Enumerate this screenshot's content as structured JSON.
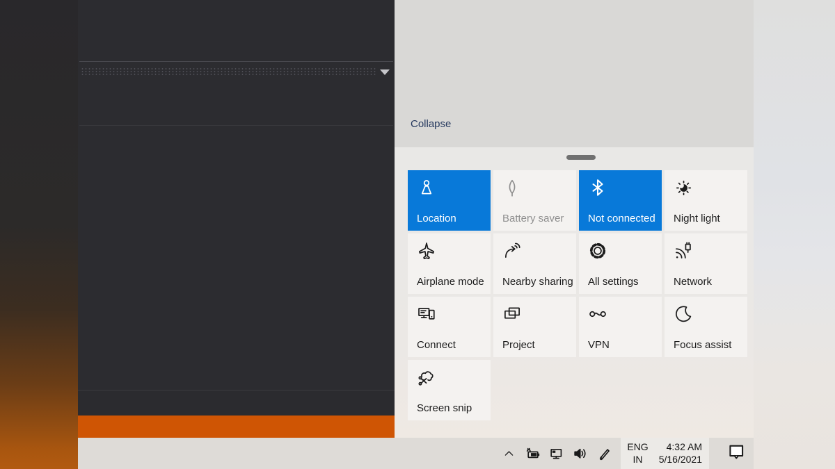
{
  "colors": {
    "accent_blue": "#0879d9",
    "orange_bar": "#cf5504",
    "dark_window": "#2c2c30",
    "panel_top_bg": "#d9d8d6",
    "panel_quick_actions_bg": "#e9e8e6",
    "tile_bg": "#f4f2f0",
    "taskbar_bg": "#dedbd7",
    "collapse_text": "#26395f"
  },
  "app_window": {
    "dropdown_icon": "chevron-down-caret"
  },
  "action_center": {
    "collapse_label": "Collapse",
    "drag_handle": "drag-handle",
    "tiles": [
      {
        "label": "Location",
        "icon": "location",
        "state": "active"
      },
      {
        "label": "Battery saver",
        "icon": "leaf",
        "state": "disabled"
      },
      {
        "label": "Not connected",
        "icon": "bluetooth",
        "state": "active"
      },
      {
        "label": "Night light",
        "icon": "sun",
        "state": "normal"
      },
      {
        "label": "Airplane mode",
        "icon": "airplane",
        "state": "normal"
      },
      {
        "label": "Nearby sharing",
        "icon": "nearby-sharing",
        "state": "normal"
      },
      {
        "label": "All settings",
        "icon": "gear",
        "state": "normal"
      },
      {
        "label": "Network",
        "icon": "network-wifi",
        "state": "normal"
      },
      {
        "label": "Connect",
        "icon": "connect-screens",
        "state": "normal"
      },
      {
        "label": "Project",
        "icon": "project-displays",
        "state": "normal"
      },
      {
        "label": "VPN",
        "icon": "vpn-link",
        "state": "normal"
      },
      {
        "label": "Focus assist",
        "icon": "moon",
        "state": "normal"
      },
      {
        "label": "Screen snip",
        "icon": "snip-scissors",
        "state": "normal"
      }
    ]
  },
  "taskbar": {
    "tray_icons": [
      {
        "name": "hidden-icons",
        "icon": "chevron-up"
      },
      {
        "name": "battery-charging",
        "icon": "battery-charging"
      },
      {
        "name": "network-status",
        "icon": "display-ethernet"
      },
      {
        "name": "volume",
        "icon": "speaker"
      },
      {
        "name": "windows-ink",
        "icon": "pen"
      }
    ],
    "language": {
      "line1": "ENG",
      "line2": "IN"
    },
    "clock": {
      "time": "4:32 AM",
      "date": "5/16/2021"
    },
    "action_center_button_icon": "notification-flag"
  }
}
